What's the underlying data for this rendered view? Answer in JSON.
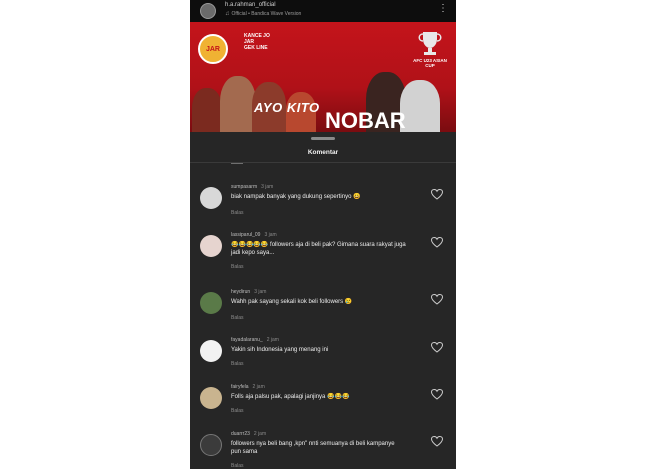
{
  "post": {
    "username": "h.a.rahman_official",
    "audio": "Official • Bandica Wave Version"
  },
  "banner": {
    "logo": "JAR",
    "logo_text_lines": [
      "KANCE JO",
      "JAR",
      "GEK LINE"
    ],
    "cup_text": "AFC U23 ASIAN CUP",
    "headline_1": "AYO KITO",
    "headline_2": "NOBAR"
  },
  "sheet": {
    "title": "Komentar"
  },
  "comments": [
    {
      "user": "sumpasarm",
      "time": "3 jam",
      "text": "biak nampak banyak yang dukung sepertinyo 😀",
      "reply": "Balas",
      "avatar_color": "#d8d8d8"
    },
    {
      "user": "lassiparul_09",
      "time": "3 jam",
      "text": "😂😂😂😂😂 followers aja di beli pak? Gimana suara rakyat juga jadi kepo saya...",
      "reply": "Balas",
      "avatar_color": "#e6d4cf"
    },
    {
      "user": "heydirun",
      "time": "3 jam",
      "text": "Wahh pak sayang sekali kok beli followers 😢",
      "reply": "Balas",
      "avatar_color": "#5a7a48"
    },
    {
      "user": "fayadalaranu_",
      "time": "2 jam",
      "text": "Yakin sih Indonesia yang menang ini",
      "reply": "Balas",
      "avatar_color": "#f2f2f2"
    },
    {
      "user": "fairyfela",
      "time": "2 jam",
      "text": "Folls aja palsu pak, apalagi janjinya 😂😂😂",
      "reply": "Balas",
      "avatar_color": "#c9b48f"
    },
    {
      "user": "duarrr23",
      "time": "2 jam",
      "text": "followers nya beli bang ,kpn\" nnti semuanya di beli kampanye pun sama",
      "reply": "Balas",
      "avatar_color": "#3b3b3b"
    }
  ],
  "colors": {
    "sheet_bg": "#262626",
    "banner_red": "#c4141b",
    "text_primary": "#ededed",
    "text_secondary": "#8d8d8d"
  },
  "icons": {
    "more": "more-vertical-icon",
    "music": "music-note-icon",
    "like": "heart-outline-icon"
  }
}
